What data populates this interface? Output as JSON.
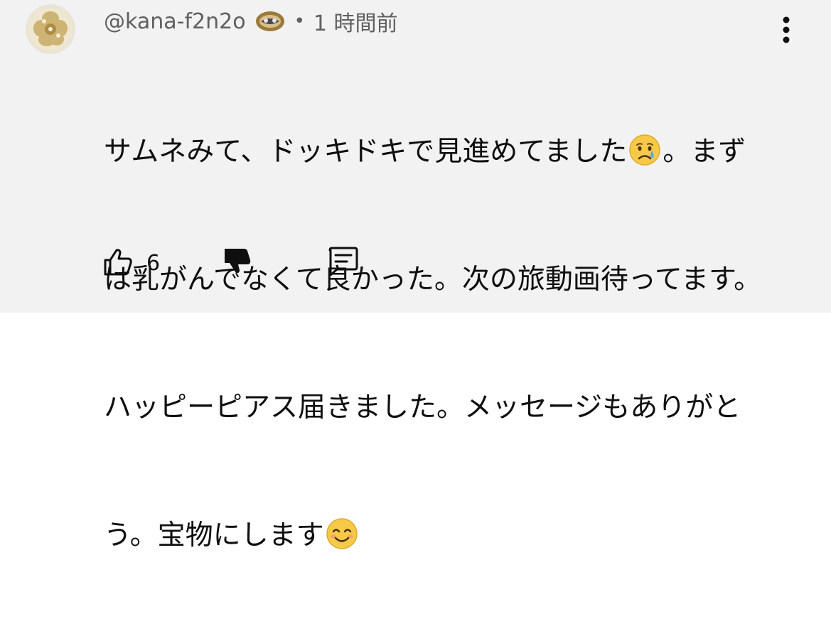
{
  "comment": {
    "author": "@kana-f2n2o",
    "separator": "•",
    "timestamp": "1 時間前",
    "lines": [
      "サムネみて、ドッキドキで見進めてました",
      "。まず",
      "は乳がんでなくて良かった。次の旅動画待ってます。",
      "ハッピーピアス届きました。メッセージもありがと",
      "う。宝物にします"
    ],
    "emojis": [
      "crying-face-emoji",
      "smiling-face-emoji"
    ]
  },
  "actions": {
    "like_count": "6",
    "icons": [
      "thumbs-up-icon",
      "thumbs-down-icon",
      "reply-icon"
    ]
  },
  "menu": {
    "icon": "more-vertical-icon"
  },
  "colors": {
    "background": "#f2f2f2",
    "text_primary": "#0f0f0f",
    "text_secondary": "#606060"
  }
}
